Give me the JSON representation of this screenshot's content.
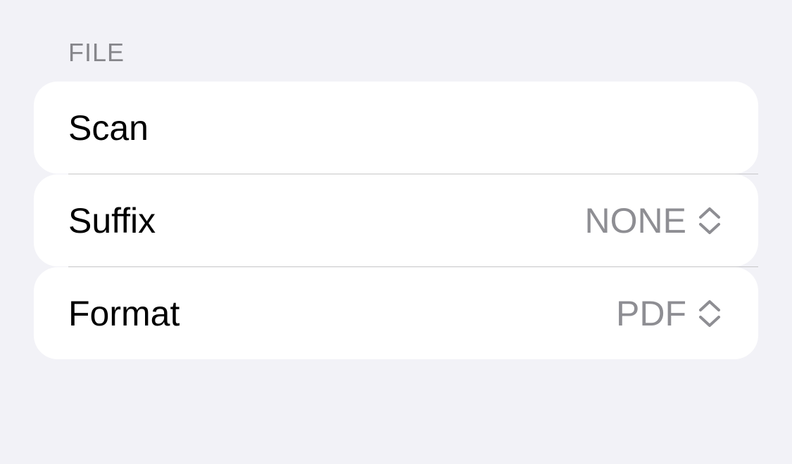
{
  "section": {
    "header": "FILE"
  },
  "rows": [
    {
      "label": "Scan"
    },
    {
      "label": "Suffix",
      "value": "NONE",
      "icon": "chevron-up-down-icon"
    },
    {
      "label": "Format",
      "value": "PDF",
      "icon": "chevron-up-down-icon"
    }
  ],
  "colors": {
    "background": "#f2f2f7",
    "cell": "#ffffff",
    "secondary_text": "#8e8e93",
    "header_text": "#86868b",
    "separator": "#c6c6c8"
  }
}
